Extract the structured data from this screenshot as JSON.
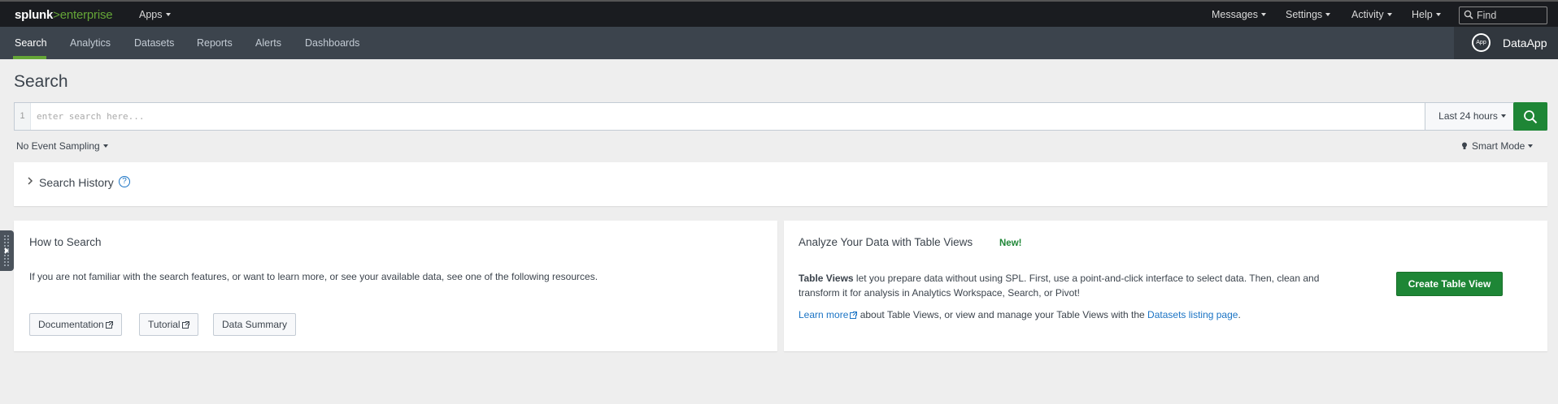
{
  "header": {
    "logo_prefix": "splunk",
    "logo_suffix": ">enterprise",
    "apps_menu": "Apps",
    "menus": [
      "Messages",
      "Settings",
      "Activity",
      "Help"
    ],
    "find_placeholder": "Find"
  },
  "nav": {
    "tabs": [
      "Search",
      "Analytics",
      "Datasets",
      "Reports",
      "Alerts",
      "Dashboards"
    ],
    "active_tab": "Search",
    "app_icon_text": "App",
    "app_name": "DataApp"
  },
  "search": {
    "page_title": "Search",
    "line_number": "1",
    "placeholder": "enter search here...",
    "time_range": "Last 24 hours",
    "event_sampling": "No Event Sampling",
    "mode": "Smart Mode"
  },
  "history": {
    "title": "Search History",
    "help": "?"
  },
  "how_to": {
    "title": "How to Search",
    "text": "If you are not familiar with the search features, or want to learn more, or see your available data, see one of the following resources.",
    "buttons": [
      "Documentation",
      "Tutorial",
      "Data Summary"
    ]
  },
  "table_views": {
    "title": "Analyze Your Data with Table Views",
    "badge": "New!",
    "desc_bold": "Table Views",
    "desc_rest": " let you prepare data without using SPL. First, use a point-and-click interface to select data. Then, clean and transform it for analysis in Analytics Workspace, Search, or Pivot!",
    "learn_more": "Learn more",
    "learn_rest": " about Table Views, or view and manage your Table Views with the ",
    "datasets_link": "Datasets listing page",
    "period": ".",
    "create_button": "Create Table View"
  },
  "colors": {
    "accent_green": "#65a637",
    "button_green": "#1e8636",
    "link_blue": "#1a73c4",
    "topbar": "#1a1c20",
    "appbar": "#3c444d"
  }
}
